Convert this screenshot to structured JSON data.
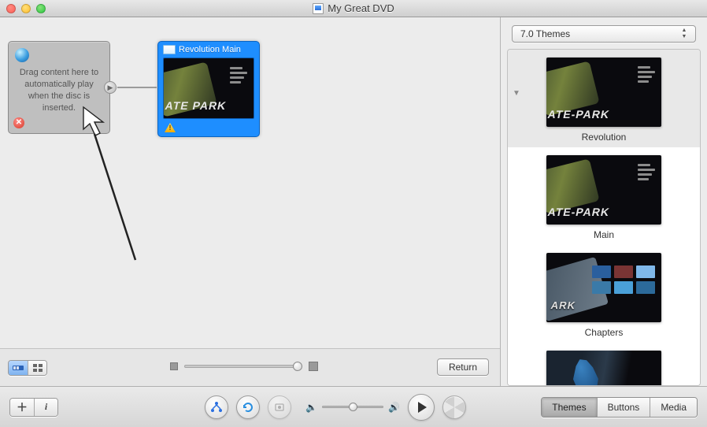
{
  "window": {
    "title": "My Great DVD"
  },
  "drop_zone": {
    "text": "Drag content here to automatically play when the disc is inserted."
  },
  "menu_node": {
    "title": "Revolution Main",
    "thumb_text": "ATE PARK"
  },
  "themes_select": {
    "label": "7.0 Themes"
  },
  "theme_items": [
    {
      "label": "Revolution",
      "thumb_text": "ATE-PARK"
    },
    {
      "label": "Main",
      "thumb_text": "ATE-PARK"
    },
    {
      "label": "Chapters",
      "thumb_text": "ARK"
    },
    {
      "label": ""
    }
  ],
  "return_btn": "Return",
  "tabs": {
    "themes": "Themes",
    "buttons": "Buttons",
    "media": "Media"
  },
  "add_info": "i"
}
